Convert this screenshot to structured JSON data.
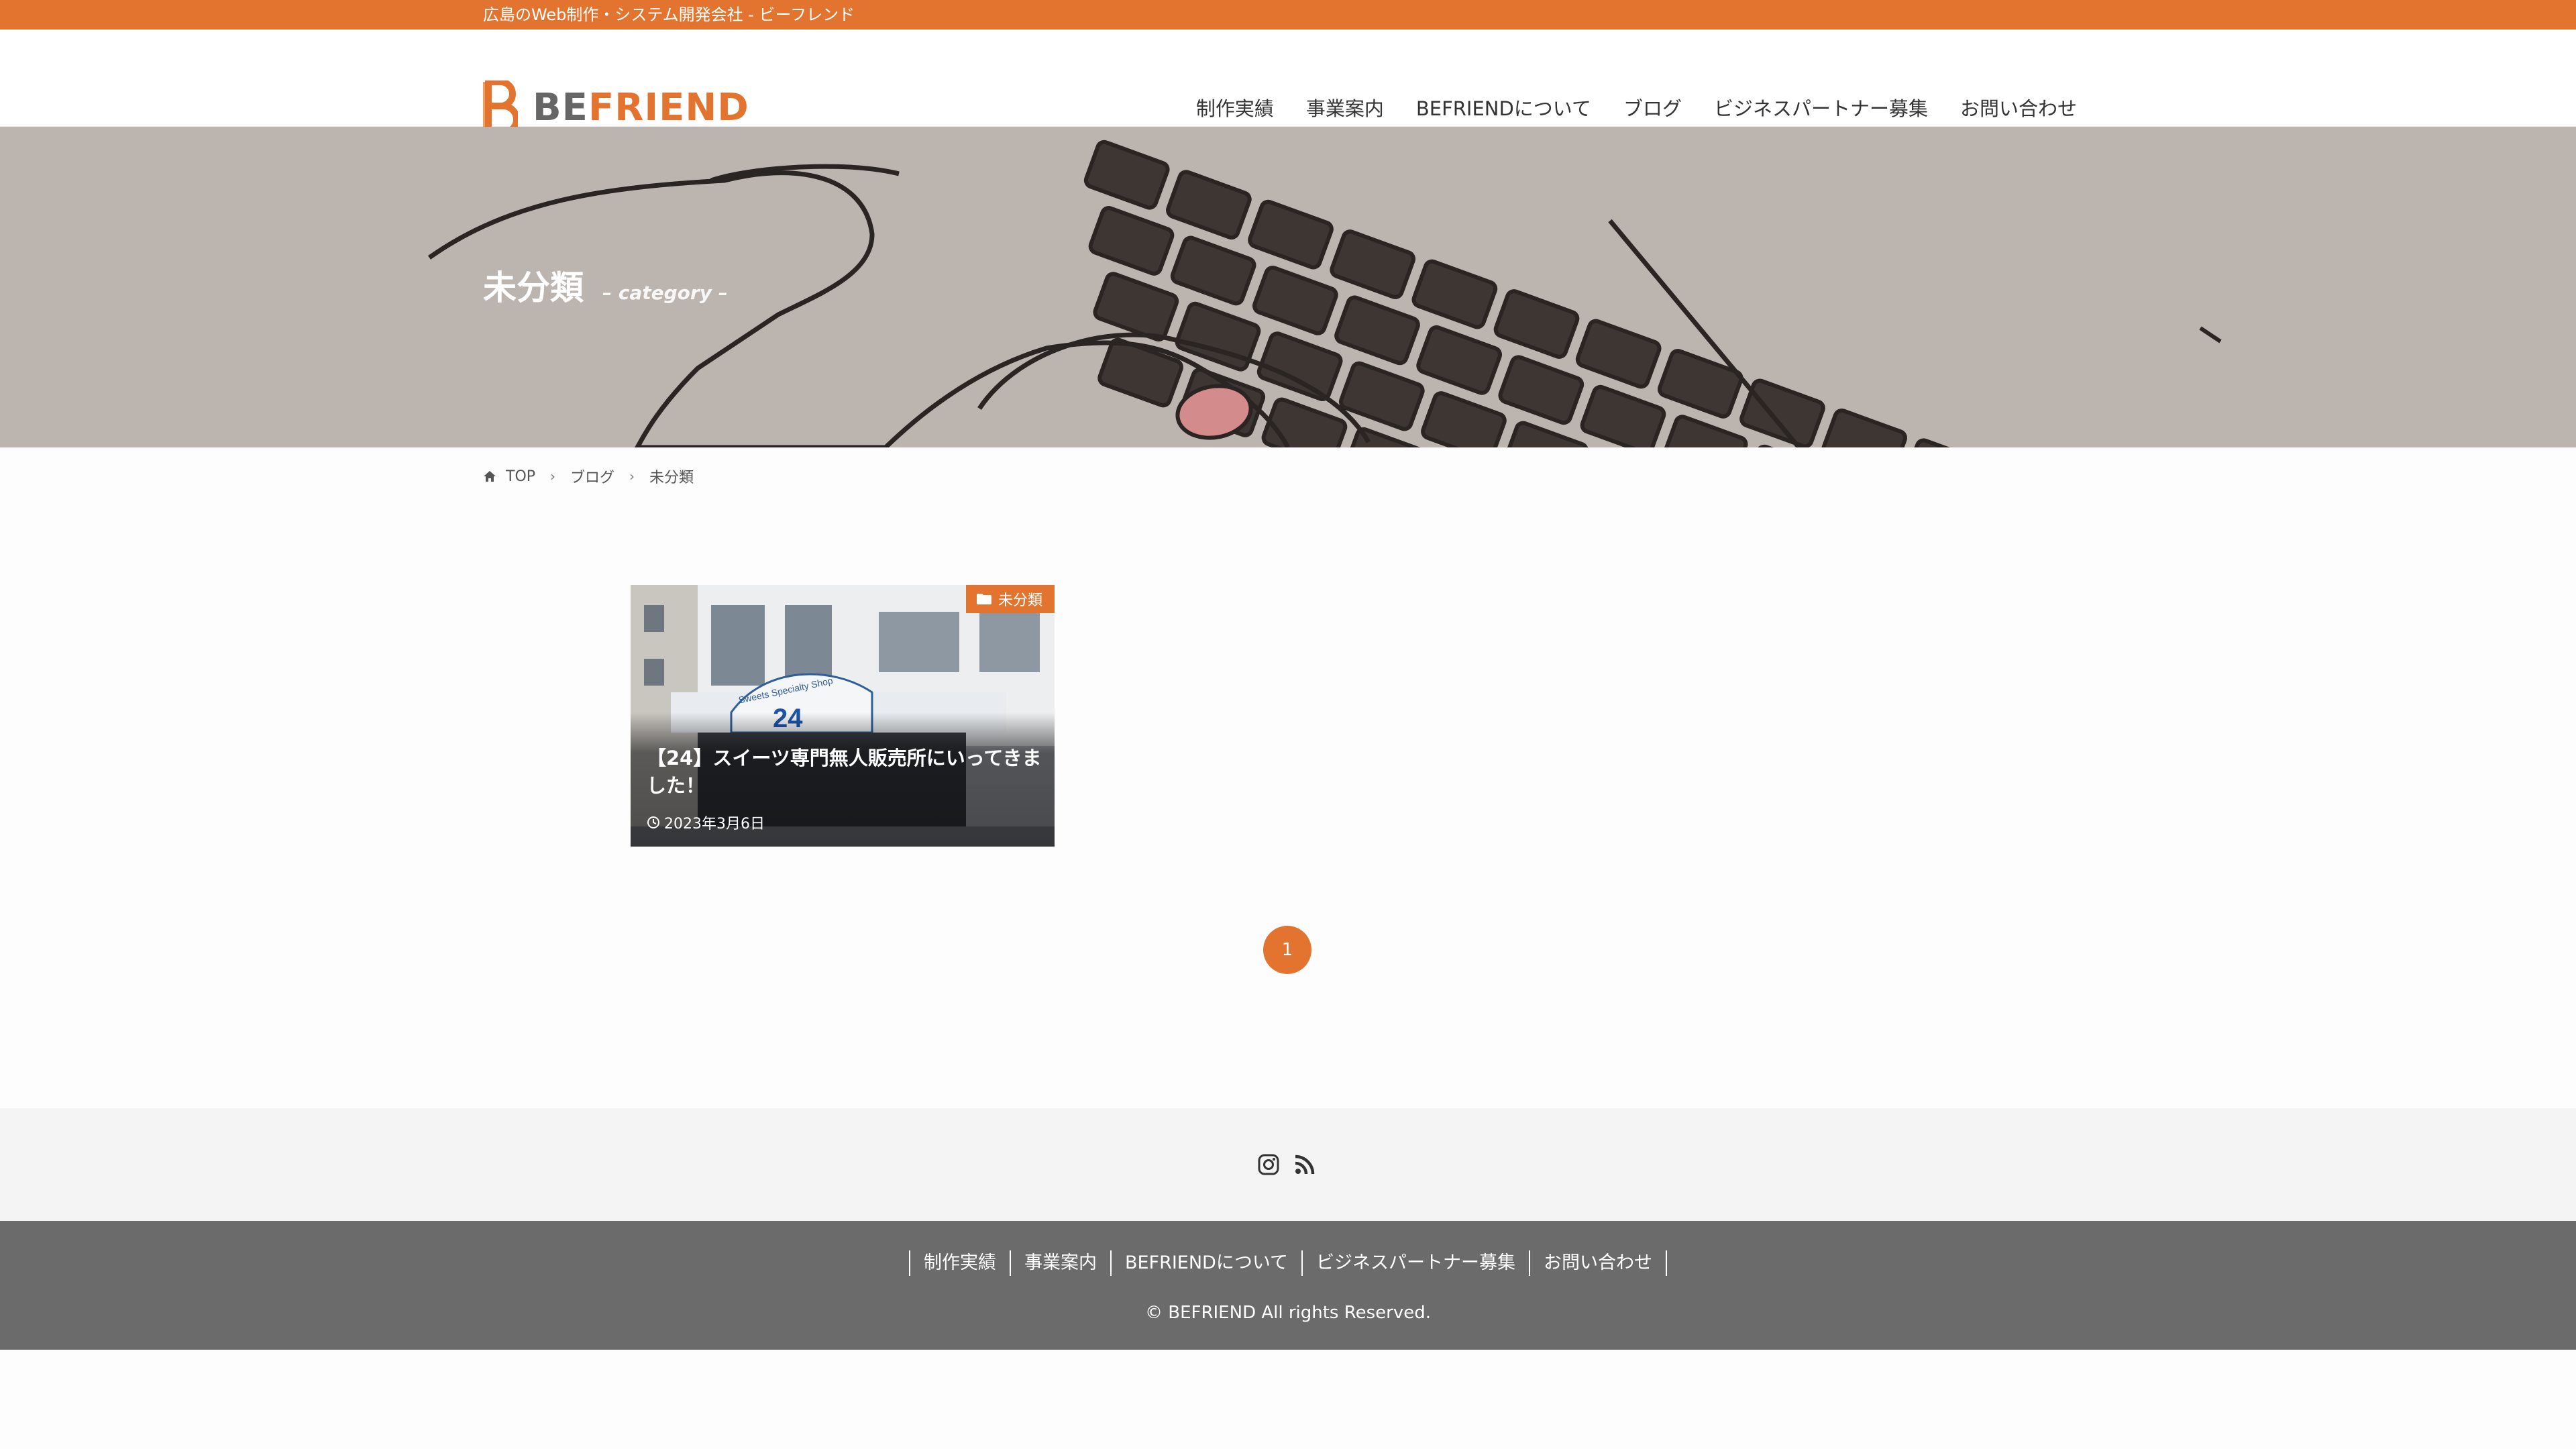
{
  "topbar": {
    "text": "広島のWeb制作・システム開発会社 - ビーフレンド"
  },
  "logo": {
    "be": "BE",
    "friend": "FRIEND"
  },
  "nav": {
    "items": [
      "制作実績",
      "事業案内",
      "BEFRIENDについて",
      "ブログ",
      "ビジネスパートナー募集",
      "お問い合わせ"
    ]
  },
  "hero": {
    "title": "未分類",
    "subtitle": "– category –"
  },
  "breadcrumb": {
    "home": "TOP",
    "blog": "ブログ",
    "current": "未分類"
  },
  "post": {
    "category": "未分類",
    "title": "【24】スイーツ専門無人販売所にいってきました！",
    "date": "2023年3月6日",
    "photo": {
      "sign_text": "Sweets Specialty Shop",
      "sign_number": "24"
    }
  },
  "pagination": {
    "current": "1"
  },
  "social": {
    "icons": [
      "instagram-icon",
      "rss-icon"
    ]
  },
  "footer": {
    "nav": [
      "制作実績",
      "事業案内",
      "BEFRIENDについて",
      "ビジネスパートナー募集",
      "お問い合わせ"
    ],
    "copyright": "© BEFRIEND All rights Reserved."
  },
  "colors": {
    "accent": "#e3742f",
    "footer_bg": "#6b6b6b",
    "hero_bg": "#bcb4ae"
  }
}
